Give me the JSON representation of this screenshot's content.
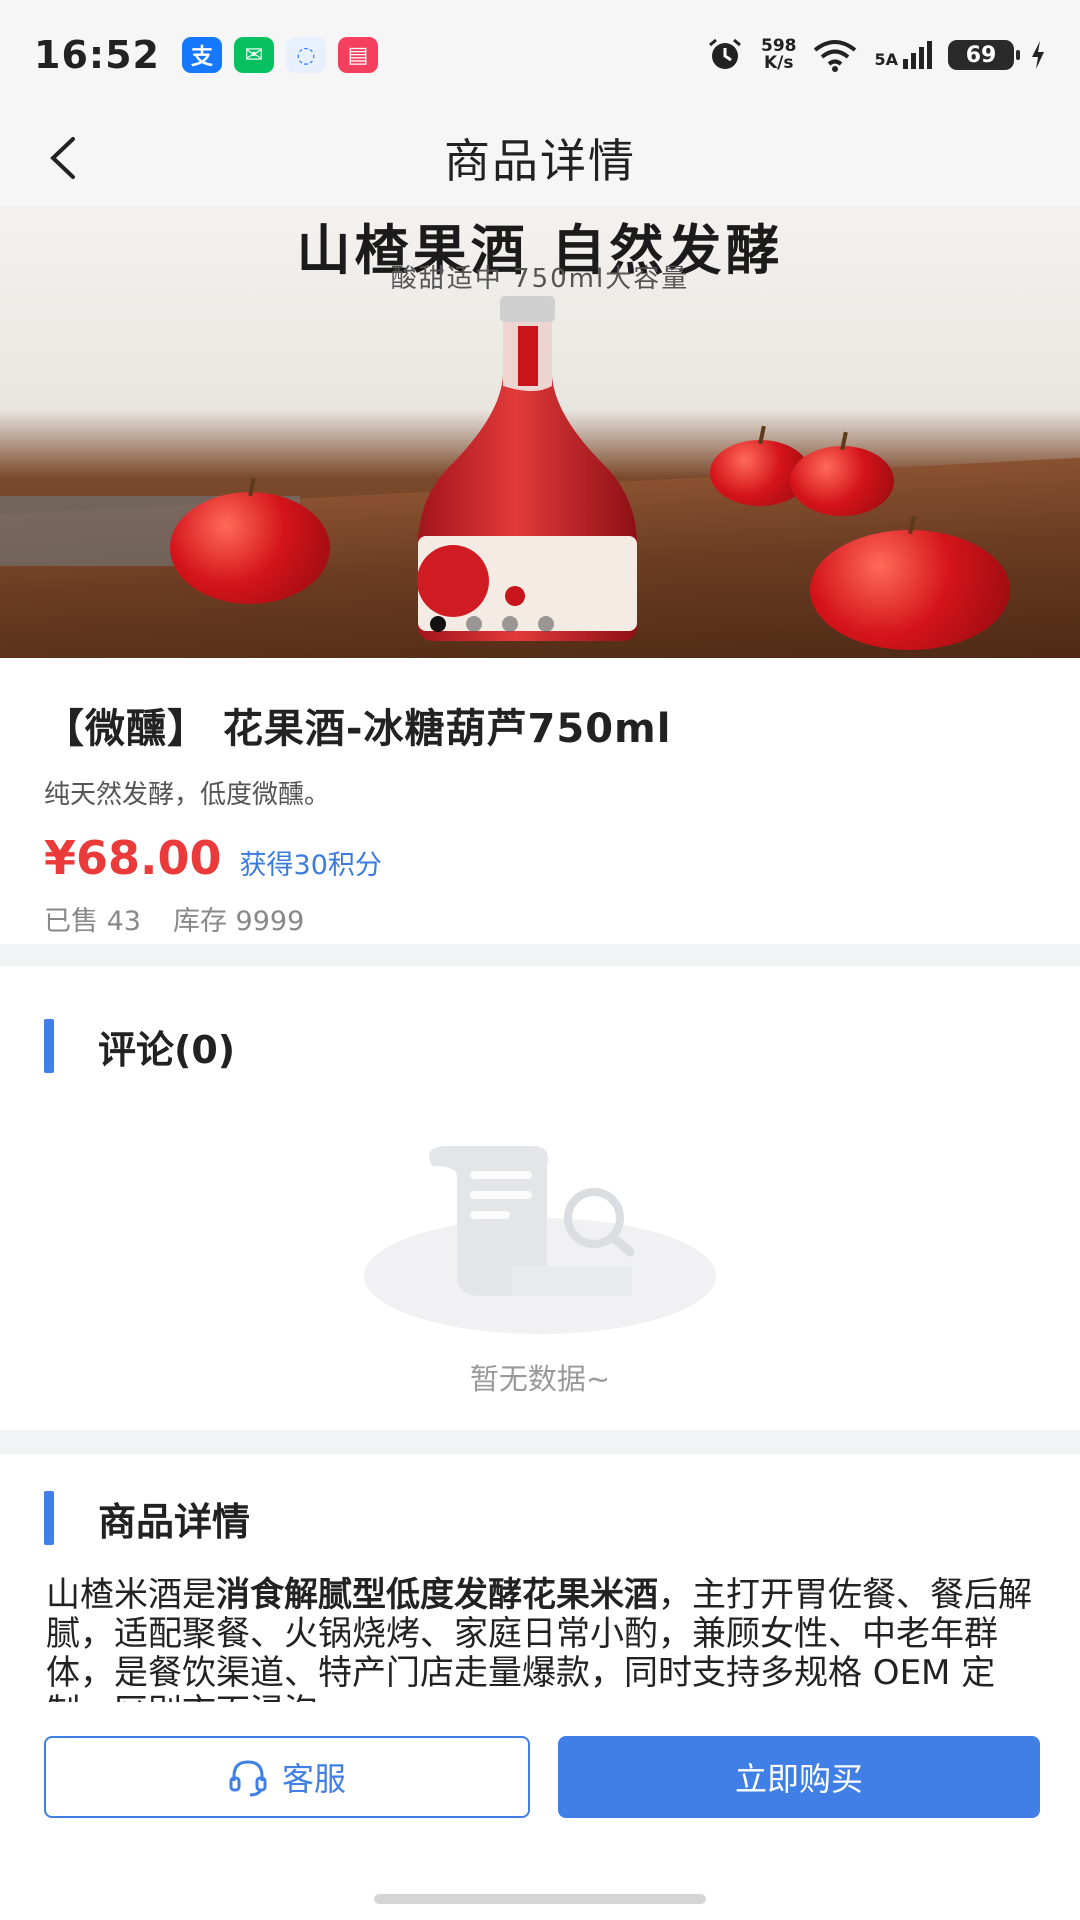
{
  "status_bar": {
    "time": "16:52",
    "apps": [
      {
        "icon": "alipay-icon",
        "glyph": "支",
        "color": "#1677ff"
      },
      {
        "icon": "wechat-icon",
        "glyph": "✉",
        "color": "#07c160"
      },
      {
        "icon": "chat-bubble-icon",
        "glyph": "◌",
        "color": "#3b82f6"
      },
      {
        "icon": "book-icon",
        "glyph": "▤",
        "color": "#f43f5e"
      }
    ],
    "speed_value": "598",
    "speed_unit": "K/s",
    "network": "5A",
    "battery": "69"
  },
  "nav": {
    "title": "商品详情"
  },
  "hero": {
    "headline": "山楂果酒 自然发酵",
    "subheadline": "酸甜适中 750ml大容量",
    "slide_count": 4,
    "active_slide": 1
  },
  "product": {
    "title": "【微醺】 花果酒-冰糖葫芦750ml",
    "description": "纯天然发酵，低度微醺。",
    "price": "¥68.00",
    "points": "获得30积分",
    "sold": "已售 43",
    "stock": "库存 9999"
  },
  "comments": {
    "title": "评论(0)",
    "empty_text": "暂无数据~"
  },
  "detail": {
    "title": "商品详情",
    "text_prefix": "山楂米酒是",
    "text_bold": "消食解腻型低度发酵花果米酒",
    "text_suffix": "，主打开胃佐餐、餐后解腻，适配聚餐、火锅烧烤、家庭日常小酌，兼顾女性、中老年群体，是餐饮渠道、特产门店走量爆款，同时支持多规格 OEM 定制，区别市面浸泡"
  },
  "actions": {
    "service_label": "客服",
    "buy_label": "立即购买"
  },
  "colors": {
    "accent": "#3f7fe6",
    "price": "#ea3a3a"
  }
}
